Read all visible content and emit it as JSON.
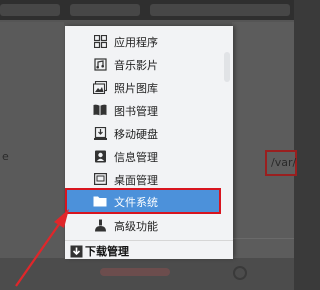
{
  "menu": {
    "items": [
      {
        "label": "应用程序",
        "icon": "grid-apps-icon"
      },
      {
        "label": "音乐影片",
        "icon": "music-film-icon"
      },
      {
        "label": "照片图库",
        "icon": "photo-gallery-icon"
      },
      {
        "label": "图书管理",
        "icon": "book-icon"
      },
      {
        "label": "移动硬盘",
        "icon": "external-drive-icon"
      },
      {
        "label": "信息管理",
        "icon": "contacts-icon"
      },
      {
        "label": "桌面管理",
        "icon": "desktop-icon"
      },
      {
        "label": "文件系统",
        "icon": "folder-icon",
        "selected": true
      },
      {
        "label": "高级功能",
        "icon": "advanced-tools-icon"
      }
    ],
    "footer": {
      "label": "下载管理",
      "icon": "download-icon"
    }
  },
  "background": {
    "left_letter": "e",
    "path_field": "/var/"
  },
  "colors": {
    "selection": "#4c91da",
    "highlight_outline": "#d8141e",
    "arrow": "#e0262a"
  }
}
